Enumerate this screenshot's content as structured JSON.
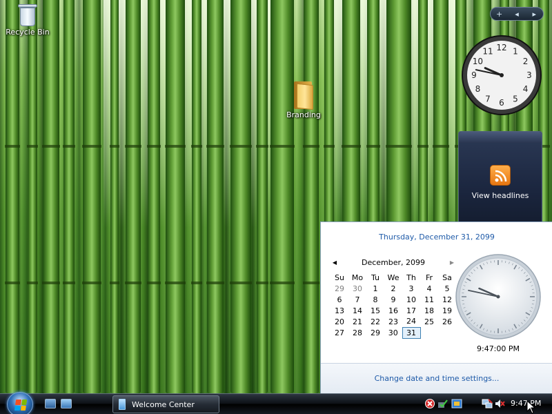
{
  "desktop": {
    "icons": [
      {
        "label": "Recycle Bin",
        "icon": "recycle-bin-icon"
      },
      {
        "label": "Branding",
        "icon": "folder-icon"
      }
    ]
  },
  "gadgets": {
    "controls": {
      "add": "+",
      "prev": "◂",
      "next": "▸"
    },
    "clock": {
      "numbers": [
        "12",
        "1",
        "2",
        "3",
        "4",
        "5",
        "6",
        "7",
        "8",
        "9",
        "10",
        "11"
      ],
      "time": "9:47"
    },
    "feed": {
      "label": "View headlines",
      "icon": "rss-icon"
    }
  },
  "flyout": {
    "date_header": "Thursday, December 31, 2099",
    "calendar": {
      "month_label": "December, 2099",
      "prev_icon": "◀",
      "next_icon": "▶",
      "weekdays": [
        "Su",
        "Mo",
        "Tu",
        "We",
        "Th",
        "Fr",
        "Sa"
      ],
      "weeks": [
        [
          "29",
          "30",
          "1",
          "2",
          "3",
          "4",
          "5"
        ],
        [
          "6",
          "7",
          "8",
          "9",
          "10",
          "11",
          "12"
        ],
        [
          "13",
          "14",
          "15",
          "16",
          "17",
          "18",
          "19"
        ],
        [
          "20",
          "21",
          "22",
          "23",
          "24",
          "25",
          "26"
        ],
        [
          "27",
          "28",
          "29",
          "30",
          "31",
          "",
          ""
        ]
      ],
      "selected_day": "31"
    },
    "time_text": "9:47:00 PM",
    "footer_link": "Change date and time settings..."
  },
  "taskbar": {
    "start": "start-button",
    "quick_launch": [
      "show-desktop-icon",
      "switch-windows-icon"
    ],
    "task_button": "Welcome Center",
    "tray_icons": [
      "security-alert-icon",
      "network-check-icon",
      "volume-adjust-icon",
      "network-icon",
      "volume-mute-icon"
    ],
    "clock": "9:47 PM"
  },
  "colors": {
    "accent": "#1e5aa8",
    "taskbar": "#0c1015",
    "feed_gadget": "#1c2740",
    "rss_orange": "#e77612"
  }
}
